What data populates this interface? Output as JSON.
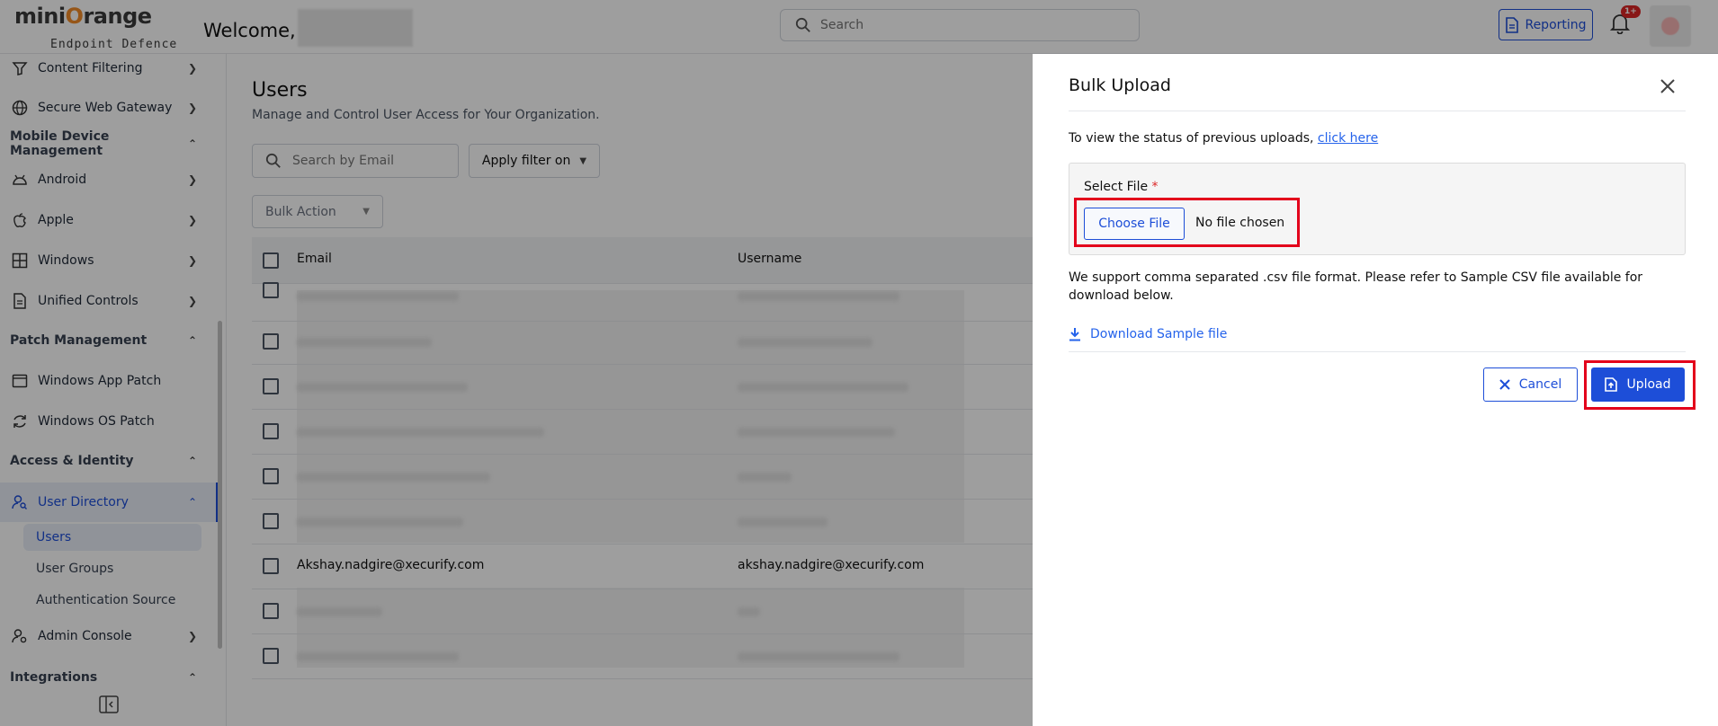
{
  "header": {
    "brand_left": "mini",
    "brand_o": "O",
    "brand_right": "range",
    "brand_sub": "Endpoint Defence",
    "welcome": "Welcome,",
    "search_placeholder": "Search",
    "reporting_label": "Reporting",
    "notification_badge": "1+"
  },
  "sidebar": {
    "items": [
      {
        "label": "Content Filtering"
      },
      {
        "label": "Secure Web Gateway"
      }
    ],
    "sections": {
      "mdm": "Mobile Device Management",
      "patch": "Patch Management",
      "access": "Access & Identity",
      "integrations": "Integrations"
    },
    "mdm_items": [
      "Android",
      "Apple",
      "Windows",
      "Unified Controls"
    ],
    "patch_items": [
      "Windows App Patch",
      "Windows OS Patch"
    ],
    "access_items": {
      "user_directory": "User Directory",
      "users": "Users",
      "user_groups": "User Groups",
      "auth_source": "Authentication Source",
      "admin_console": "Admin Console"
    }
  },
  "main": {
    "title": "Users",
    "subtitle": "Manage and Control User Access for Your Organization.",
    "email_search_placeholder": "Search by Email",
    "filter_label": "Apply filter on",
    "bulk_action_label": "Bulk Action",
    "columns": {
      "email": "Email",
      "username": "Username"
    },
    "visible_row": {
      "email": "Akshay.nadgire@xecurify.com",
      "username": "akshay.nadgire@xecurify.com"
    }
  },
  "drawer": {
    "title": "Bulk Upload",
    "status_text": "To view the status of previous uploads, ",
    "status_link": "click here",
    "select_file_label": "Select File ",
    "required_mark": "*",
    "choose_file_label": "Choose File",
    "no_file_text": "No file chosen",
    "support_text": "We support comma separated .csv file format. Please refer to Sample CSV file available for download below.",
    "download_label": "Download Sample file",
    "cancel_label": "Cancel",
    "upload_label": "Upload"
  },
  "colors": {
    "accent": "#1d4ed8",
    "highlight": "#e3001b",
    "brand_orange": "#f28c28"
  }
}
